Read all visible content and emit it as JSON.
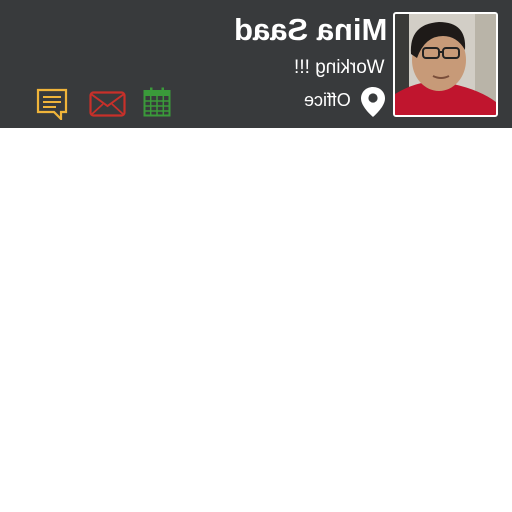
{
  "profile": {
    "name": "Mina Saad",
    "status": "Working !!!",
    "location": "Office"
  },
  "icons": {
    "avatar": "profile-photo",
    "location": "map-pin-icon",
    "chat": "chat-icon",
    "mail": "mail-icon",
    "calendar": "calendar-icon"
  },
  "colors": {
    "header_bg": "#383a3c",
    "chat": "#f0b43a",
    "mail": "#c8302a",
    "calendar": "#3a9a3a"
  }
}
